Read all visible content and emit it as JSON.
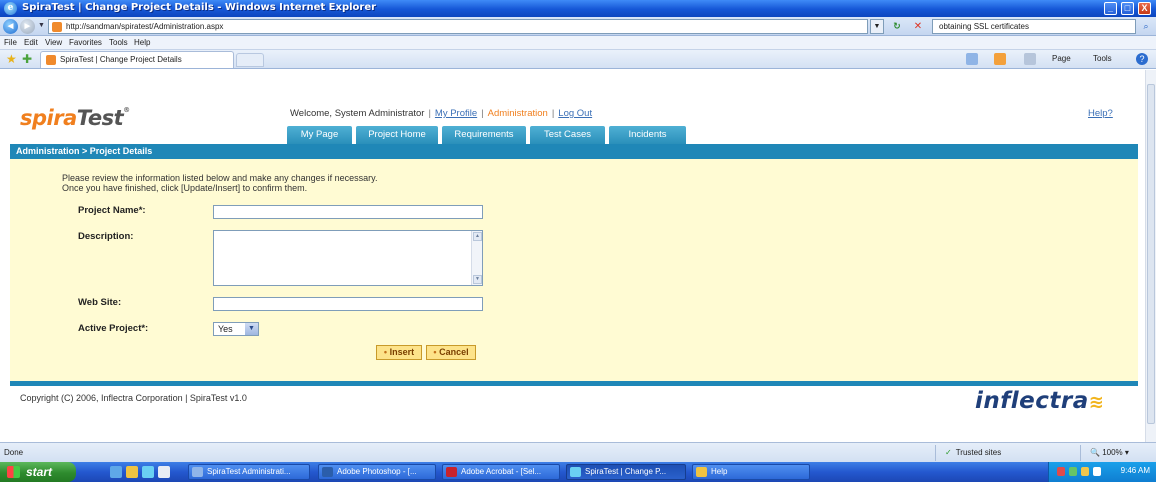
{
  "window": {
    "title": "SpiraTest | Change Project Details - Windows Internet Explorer",
    "minimize": "_",
    "maximize": "□",
    "close": "X"
  },
  "addressbar": {
    "url": "http://sandman/spiratest/Administration.aspx",
    "search_value": "obtaining SSL certificates"
  },
  "menu": [
    "File",
    "Edit",
    "View",
    "Favorites",
    "Tools",
    "Help"
  ],
  "browser_tab": {
    "label": "SpiraTest | Change Project Details"
  },
  "commandbar": {
    "page": "Page",
    "tools": "Tools"
  },
  "app": {
    "logo_a": "spira",
    "logo_b": "Test",
    "logo_tm": "®",
    "welcome_text": "Welcome, System Administrator",
    "my_profile": "My Profile",
    "administration": "Administration",
    "logout": "Log Out",
    "help": "Help?",
    "tabs": [
      "My Page",
      "Project Home",
      "Requirements",
      "Test Cases",
      "Incidents"
    ],
    "breadcrumb": "Administration > Project Details"
  },
  "form": {
    "intro_line1": "Please review the information listed below and make any changes if necessary.",
    "intro_line2": "Once you have finished, click [Update/Insert] to confirm them.",
    "project_name_label": "Project Name*:",
    "project_name_value": "",
    "description_label": "Description:",
    "description_value": "",
    "website_label": "Web Site:",
    "website_value": "",
    "active_label": "Active Project*:",
    "active_value": "Yes",
    "insert_label": "Insert",
    "cancel_label": "Cancel"
  },
  "footer": {
    "copyright": "Copyright (C) 2006, Inflectra Corporation | SpiraTest v1.0",
    "brand": "inflectra"
  },
  "status": {
    "done": "Done",
    "zone": "Trusted sites",
    "zoom": "100%"
  },
  "taskbar": {
    "start": "start",
    "tasks": [
      "SpiraTest Administrati...",
      "Adobe Photoshop - [...",
      "Adobe Acrobat - [Sel...",
      "SpiraTest | Change P...",
      "Help"
    ],
    "clock": "9:46 AM"
  }
}
